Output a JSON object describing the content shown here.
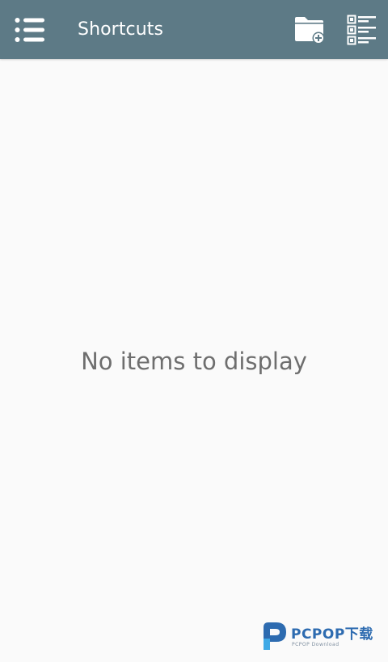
{
  "app_bar": {
    "title": "Shortcuts",
    "background": "#5d7a86",
    "menu_icon": "menu-list-icon",
    "new_folder_icon": "folder-add-icon",
    "view_icon": "checklist-view-icon"
  },
  "content": {
    "empty_message": "No items to display"
  },
  "watermark": {
    "brand": "PCPOP下载",
    "sub": "PCPOP Download"
  }
}
